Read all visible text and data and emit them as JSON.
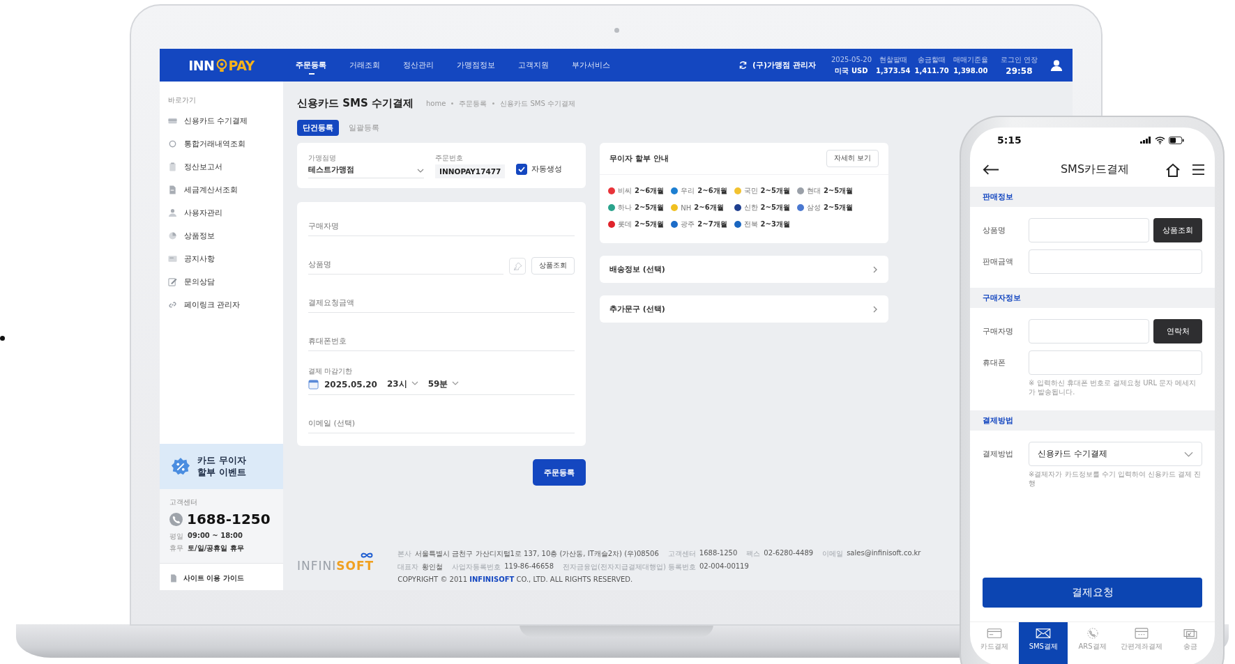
{
  "laptop": {
    "nav": {
      "logo": {
        "left": "INN",
        "right": "PAY"
      },
      "menu": [
        {
          "label": "주문등록",
          "selected": true
        },
        {
          "label": "거래조회",
          "selected": false
        },
        {
          "label": "정산관리",
          "selected": false
        },
        {
          "label": "가맹점정보",
          "selected": false
        },
        {
          "label": "고객지원",
          "selected": false
        },
        {
          "label": "부가서비스",
          "selected": false
        }
      ],
      "merchant": "(구)가맹점 관리자",
      "rates": {
        "date": "2025-05-20",
        "headers": [
          "현찰팔때",
          "송금할때",
          "매매기준율"
        ],
        "currency": "미국 USD",
        "values": [
          "1,373.54",
          "1,411.70",
          "1,398.00"
        ]
      },
      "session": {
        "label": "로그인 연장",
        "time": "29:58"
      }
    },
    "sidebar": {
      "heading": "바로가기",
      "items": [
        {
          "label": "신용카드 수기결제",
          "kind": "card"
        },
        {
          "label": "통합거래내역조회",
          "kind": "search"
        },
        {
          "label": "정산보고서",
          "kind": "clipboard"
        },
        {
          "label": "세금계산서조회",
          "kind": "document"
        },
        {
          "label": "사용자관리",
          "kind": "user"
        },
        {
          "label": "상품정보",
          "kind": "box"
        },
        {
          "label": "공지사항",
          "kind": "notice"
        },
        {
          "label": "문의상담",
          "kind": "pencil"
        },
        {
          "label": "페이링크 관리자",
          "kind": "link"
        }
      ],
      "event": "카드 무이자\n할부 이벤트",
      "support": {
        "label": "고객센터",
        "phone": "1688-1250",
        "hours": [
          {
            "label": "평일",
            "value": "09:00 ~ 18:00"
          },
          {
            "label": "휴무",
            "value": "토/일/공휴일 휴무"
          }
        ]
      },
      "guide": "사이트 이용 가이드"
    },
    "page": {
      "title": "신용카드 SMS 수기결제",
      "breadcrumb": [
        "home",
        "주문등록",
        "신용카드 SMS 수기결제"
      ],
      "tabs": [
        {
          "label": "단건등록",
          "selected": true
        },
        {
          "label": "일괄등록",
          "selected": false
        }
      ],
      "merchant_field": {
        "label": "가맹점명",
        "value": "테스트가맹점"
      },
      "order_field": {
        "label": "주문번호",
        "value": "INNOPAY17477"
      },
      "auto_generate": {
        "label": "자동생성",
        "checked": true
      },
      "fields": [
        {
          "kind": "text",
          "placeholder": "구매자명"
        },
        {
          "kind": "product",
          "placeholder": "상품명",
          "button": "상품조회"
        },
        {
          "kind": "text",
          "placeholder": "결제요청금액"
        },
        {
          "kind": "text",
          "placeholder": "휴대폰번호"
        },
        {
          "kind": "deadline",
          "label": "결제 마감기한",
          "date": "2025.05.20",
          "hour": "23시",
          "minute": "59분"
        },
        {
          "kind": "text",
          "placeholder": "이메일 (선택)"
        }
      ],
      "submit": "주문등록",
      "installments": {
        "title": "무이자 할부 안내",
        "button": "자세히 보기",
        "cards": [
          {
            "name": "비씨",
            "months": "2~6개월",
            "color": "#e8333a"
          },
          {
            "name": "우리",
            "months": "2~6개월",
            "color": "#1d7fd1"
          },
          {
            "name": "국민",
            "months": "2~5개월",
            "color": "#f2c230"
          },
          {
            "name": "현대",
            "months": "2~5개월",
            "color": "#9aa0a8"
          },
          {
            "name": "하나",
            "months": "2~5개월",
            "color": "#2aa38c"
          },
          {
            "name": "NH",
            "months": "2~6개월",
            "color": "#f0c020"
          },
          {
            "name": "신한",
            "months": "2~5개월",
            "color": "#1f3f8f"
          },
          {
            "name": "삼성",
            "months": "2~5개월",
            "color": "#4a78d0"
          },
          {
            "name": "롯데",
            "months": "2~5개월",
            "color": "#e0232b"
          },
          {
            "name": "광주",
            "months": "2~7개월",
            "color": "#1c6cc8"
          },
          {
            "name": "전북",
            "months": "2~3개월",
            "color": "#1a66c0"
          }
        ]
      },
      "sections": [
        {
          "label": "배송정보 (선택)"
        },
        {
          "label": "추가문구 (선택)"
        }
      ],
      "footer": {
        "logo": {
          "left": "INFINI",
          "right": "SOFT"
        },
        "lines": [
          [
            {
              "label": "본사",
              "value": "서울특별시 금천구 가산디지털1로 137, 10층 (가산동, IT캐슬2차) (우)08506"
            },
            {
              "label": "고객센터",
              "value": "1688-1250"
            },
            {
              "label": "팩스",
              "value": "02-6280-4489"
            },
            {
              "label": "이메일",
              "value": "sales@infinisoft.co.kr"
            }
          ],
          [
            {
              "label": "대표자",
              "value": "황인철"
            },
            {
              "label": "사업자등록번호",
              "value": "119-86-46658"
            },
            {
              "label": "전자금융업(전자지급결제대행업) 등록번호",
              "value": "02-004-00119"
            }
          ]
        ],
        "copyright": "COPYRIGHT © 2011 **INFINISOFT** CO., LTD. ALL RIGHTS RESERVED."
      }
    }
  },
  "phone": {
    "time": "5:15",
    "title": "SMS카드결제",
    "sections": [
      {
        "title": "판매정보",
        "rows": [
          {
            "label": "상품명",
            "button": "상품조회"
          },
          {
            "label": "판매금액"
          }
        ]
      },
      {
        "title": "구매자정보",
        "rows": [
          {
            "label": "구매자명",
            "button": "연락처"
          },
          {
            "label": "휴대폰",
            "note": "※ 입력하신 휴대폰 번호로 결제요청 URL 문자 메세지가 발송됩니다."
          }
        ]
      },
      {
        "title": "결제방법",
        "rows": [
          {
            "label": "결제방법",
            "select": "신용카드 수기결제",
            "note": "※결제자가 카드정보를 수기 입력하여 신용카드 결제 진행"
          }
        ]
      }
    ],
    "submit": "결제요청",
    "tabs": [
      {
        "label": "카드결제",
        "kind": "card",
        "selected": false
      },
      {
        "label": "SMS결제",
        "kind": "mail",
        "selected": true
      },
      {
        "label": "ARS결제",
        "kind": "phone",
        "selected": false
      },
      {
        "label": "간편계좌결제",
        "kind": "atm",
        "selected": false
      },
      {
        "label": "송금",
        "kind": "transfer",
        "selected": false
      }
    ]
  }
}
